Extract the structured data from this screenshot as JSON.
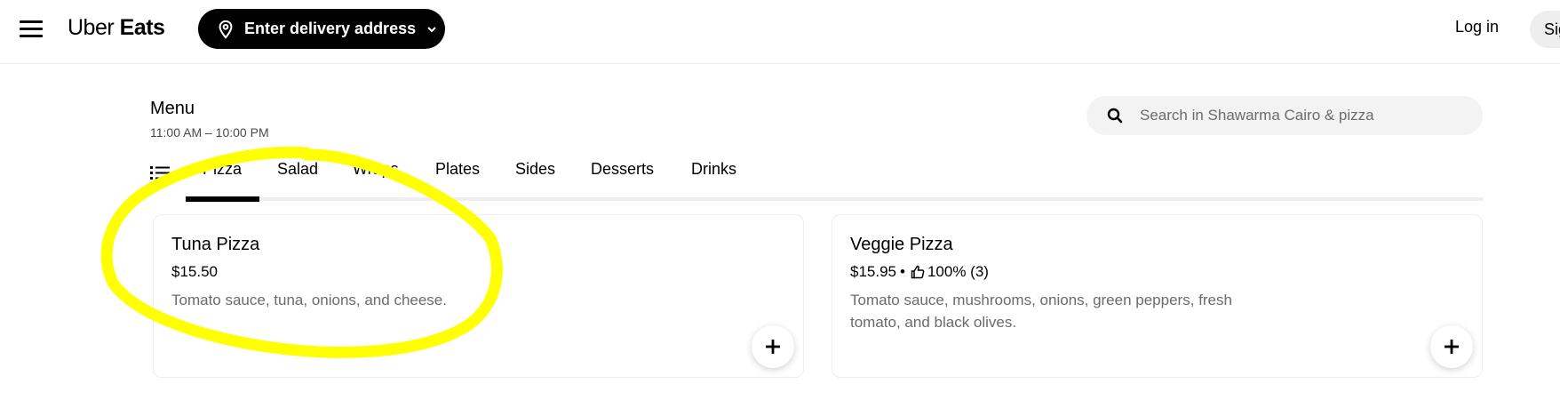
{
  "header": {
    "logo_prefix": "Uber",
    "logo_suffix": "Eats",
    "address_button_label": "Enter delivery address",
    "login_label": "Log in",
    "signup_label": "Sign up"
  },
  "menu": {
    "title": "Menu",
    "hours": "11:00 AM – 10:00 PM"
  },
  "search": {
    "placeholder": "Search in Shawarma Cairo & pizza",
    "value": ""
  },
  "tabs": [
    {
      "label": "Pizza",
      "active": true
    },
    {
      "label": "Salad",
      "active": false
    },
    {
      "label": "Wraps",
      "active": false
    },
    {
      "label": "Plates",
      "active": false
    },
    {
      "label": "Sides",
      "active": false
    },
    {
      "label": "Desserts",
      "active": false
    },
    {
      "label": "Drinks",
      "active": false
    }
  ],
  "items": [
    {
      "name": "Tuna Pizza",
      "price": "$15.50",
      "description": "Tomato sauce, tuna, onions, and cheese."
    },
    {
      "name": "Veggie Pizza",
      "price": "$15.95",
      "separator": "•",
      "rating": "100% (3)",
      "description": "Tomato sauce, mushrooms, onions, green peppers, fresh tomato, and black olives."
    }
  ],
  "icons": {
    "menu": "hamburger-icon",
    "location": "location-pin-icon",
    "dropdown": "chevron-down-icon",
    "search": "search-icon",
    "category_list": "list-icon",
    "rating": "thumbs-up-icon",
    "add": "plus-icon"
  },
  "colors": {
    "primary": "#000000",
    "background": "#ffffff",
    "muted_text": "#6b6b6b",
    "surface": "#eeeeee",
    "highlight": "#ffff00"
  }
}
